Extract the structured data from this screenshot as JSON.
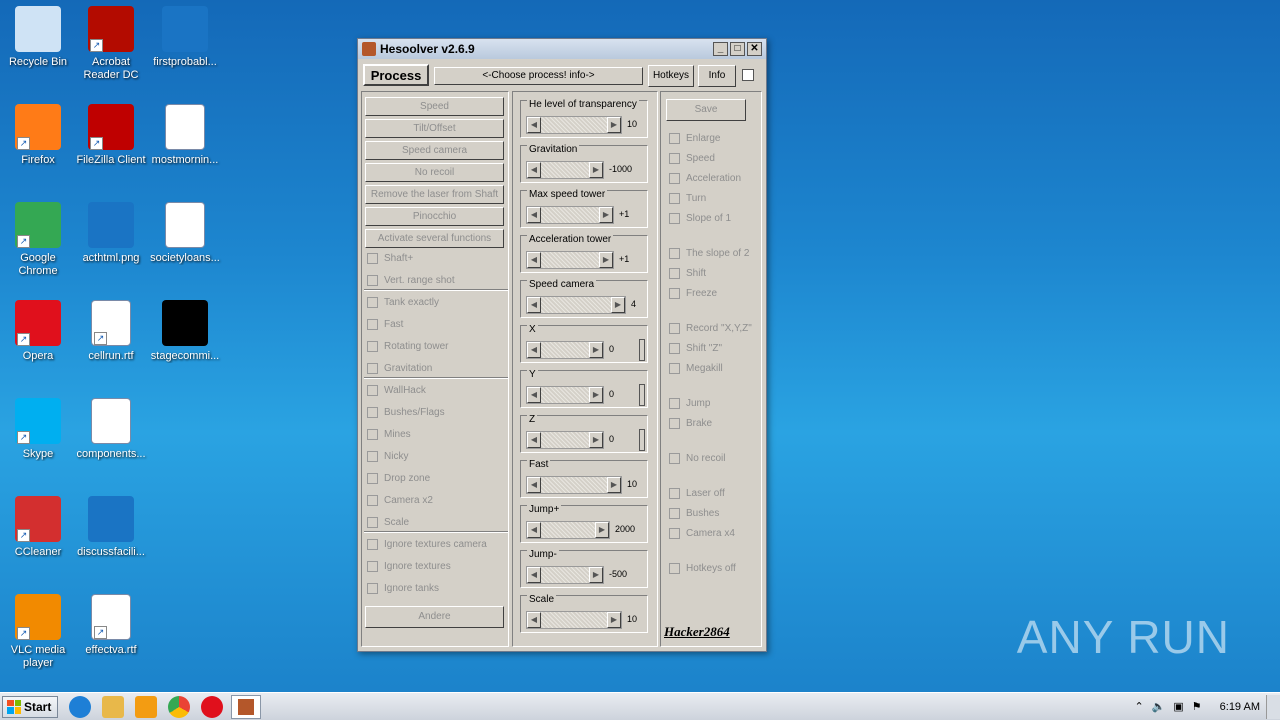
{
  "desktop": {
    "icons": [
      {
        "label": "Recycle Bin",
        "icon": "recycle-bin-icon",
        "color": "#cfe3f5",
        "shortcut": false
      },
      {
        "label": "Acrobat Reader DC",
        "icon": "acrobat-icon",
        "color": "#b30b00",
        "shortcut": true
      },
      {
        "label": "firstprobabl...",
        "icon": "blank-file-icon",
        "color": "#1a74c4",
        "shortcut": false
      },
      {
        "label": "Firefox",
        "icon": "firefox-icon",
        "color": "#ff7b17",
        "shortcut": true
      },
      {
        "label": "FileZilla Client",
        "icon": "filezilla-icon",
        "color": "#bf0000",
        "shortcut": true
      },
      {
        "label": "mostmornin...",
        "icon": "word-doc-icon",
        "color": "#ffffff",
        "shortcut": false
      },
      {
        "label": "Google Chrome",
        "icon": "chrome-icon",
        "color": "#34a853",
        "shortcut": true
      },
      {
        "label": "acthtml.png",
        "icon": "image-file-icon",
        "color": "#1a74c4",
        "shortcut": false
      },
      {
        "label": "societyloans...",
        "icon": "word-doc-icon",
        "color": "#ffffff",
        "shortcut": false
      },
      {
        "label": "Opera",
        "icon": "opera-icon",
        "color": "#e0101c",
        "shortcut": true
      },
      {
        "label": "cellrun.rtf",
        "icon": "word-doc-icon",
        "color": "#ffffff",
        "shortcut": true
      },
      {
        "label": "stagecommi...",
        "icon": "black-file-icon",
        "color": "#000000",
        "shortcut": false
      },
      {
        "label": "Skype",
        "icon": "skype-icon",
        "color": "#00aff0",
        "shortcut": true
      },
      {
        "label": "components...",
        "icon": "word-doc-icon",
        "color": "#ffffff",
        "shortcut": false
      },
      {
        "label": "CCleaner",
        "icon": "ccleaner-icon",
        "color": "#d32f2f",
        "shortcut": true
      },
      {
        "label": "discussfacili...",
        "icon": "blank-file-icon",
        "color": "#1a74c4",
        "shortcut": false
      },
      {
        "label": "VLC media player",
        "icon": "vlc-icon",
        "color": "#f28a00",
        "shortcut": true
      },
      {
        "label": "effectva.rtf",
        "icon": "word-doc-icon",
        "color": "#ffffff",
        "shortcut": true
      }
    ],
    "watermark": "ANY RUN"
  },
  "window": {
    "title": "Hesoolver v2.6.9",
    "process_label": "Process",
    "choose_label": "<-Choose process! info->",
    "hotkeys_label": "Hotkeys",
    "info_label": "Info",
    "left_buttons": [
      "Speed",
      "Tilt/Offset",
      "Speed camera",
      "No recoil",
      "Remove the laser from Shaft",
      "Pinocchio",
      "Activate several functions"
    ],
    "left_checks": [
      "Shaft+",
      "Vert. range shot",
      "Tank exactly",
      "Fast",
      "Rotating tower",
      "Gravitation",
      "WallHack",
      "Bushes/Flags",
      "Mines",
      "Nicky",
      "Drop zone",
      "Camera x2",
      "Scale",
      "Ignore textures camera",
      "Ignore textures",
      "Ignore tanks"
    ],
    "andere_label": "Andere",
    "sliders": [
      {
        "label": "He level of transparency",
        "value": "10"
      },
      {
        "label": "Gravitation",
        "value": "-1000"
      },
      {
        "label": "Max speed tower",
        "value": "+1"
      },
      {
        "label": "Acceleration tower",
        "value": "+1"
      },
      {
        "label": "Speed camera",
        "value": "4"
      },
      {
        "label": "X",
        "value": "0"
      },
      {
        "label": "Y",
        "value": "0"
      },
      {
        "label": "Z",
        "value": "0"
      },
      {
        "label": "Fast",
        "value": "10"
      },
      {
        "label": "Jump+",
        "value": "2000"
      },
      {
        "label": "Jump-",
        "value": "-500"
      },
      {
        "label": "Scale",
        "value": "10"
      }
    ],
    "save_label": "Save",
    "right_checks": [
      "Enlarge",
      "Speed",
      "Acceleration",
      "Turn",
      "Slope of 1",
      "The slope of 2",
      "Shift",
      "Freeze",
      "Record \"X,Y,Z\"",
      "Shift \"Z\"",
      "Megakill",
      "Jump",
      "Brake",
      "No recoil",
      "Laser off",
      "Bushes",
      "Camera x4",
      "Hotkeys off"
    ],
    "signature": "Hacker2864"
  },
  "taskbar": {
    "start_label": "Start",
    "clock": "6:19 AM"
  }
}
